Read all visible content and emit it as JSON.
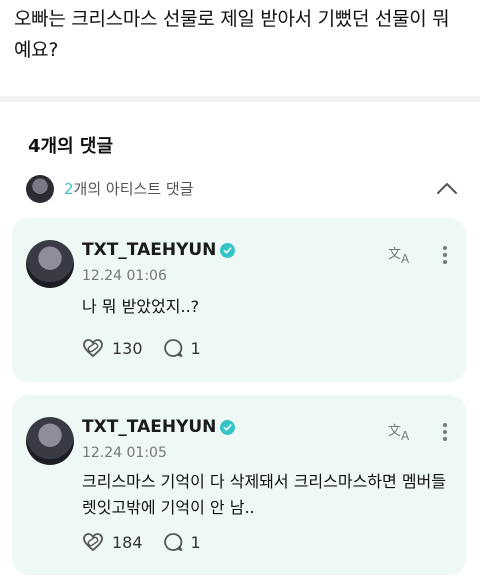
{
  "question": {
    "text": "오빠는 크리스마스 선물로 제일 받아서 기뻤던 선물이 뭐예요?"
  },
  "comments_section": {
    "count_label": "4개의 댓글",
    "artist_bar": {
      "count": "2",
      "suffix": "개의 아티스트 댓글"
    }
  },
  "comments": [
    {
      "author": "TXT_TAEHYUN",
      "time": "12.24 01:06",
      "text": "나 뭐 받았었지..?",
      "likes": "130",
      "replies": "1"
    },
    {
      "author": "TXT_TAEHYUN",
      "time": "12.24 01:05",
      "text": "크리스마스 기억이 다 삭제돼서 크리스마스하면 멤버들 렛잇고밖에 기억이 안 남..",
      "likes": "184",
      "replies": "1"
    }
  ],
  "colors": {
    "accent": "#3fc1c9",
    "card_bg": "#eef9f6"
  },
  "icons": [
    "verified-badge-icon",
    "translate-icon",
    "more-options-icon",
    "heart-bandage-icon",
    "reply-bubble-icon",
    "chevron-up-icon"
  ]
}
